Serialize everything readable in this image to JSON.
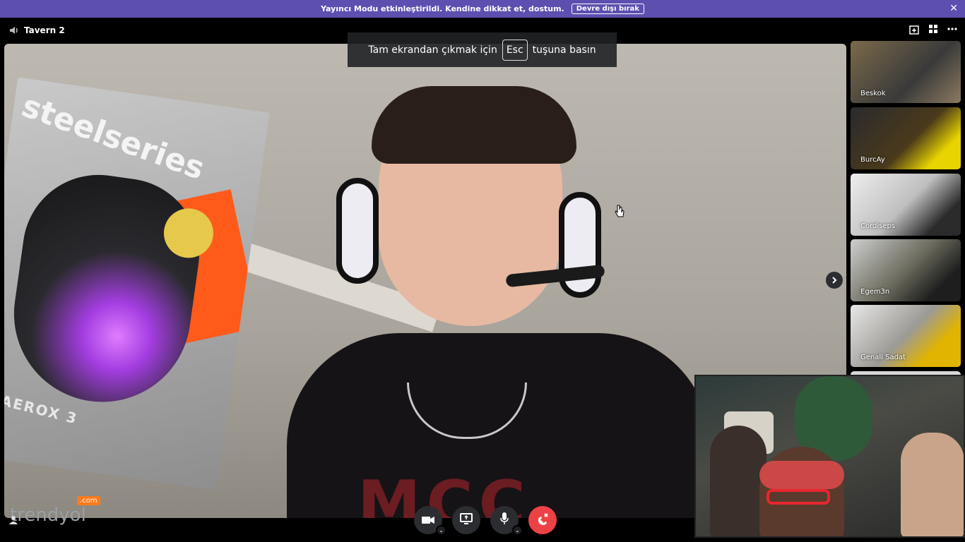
{
  "banner": {
    "message": "Yayıncı Modu etkinleştirildi. Kendine dikkat et, dostum.",
    "dismiss_label": "Devre dışı bırak",
    "close_glyph": "✕"
  },
  "topbar": {
    "channel_icon": "speaker-icon",
    "channel_name": "Tavern 2"
  },
  "fullscreen_hint": {
    "before": "Tam ekrandan çıkmak için",
    "key": "Esc",
    "after": "tuşuna basın"
  },
  "main_video": {
    "box_brand": "steelseries",
    "box_product": "AEROX 3",
    "shirt_logo": "MCC"
  },
  "watermark": {
    "text": "trendyol",
    "dotcom": ".com"
  },
  "sidebar_tools": {
    "icons": [
      "add-activity-icon",
      "grid-icon",
      "more-icon"
    ]
  },
  "participants": [
    {
      "name": "Beskok"
    },
    {
      "name": "BurcAy"
    },
    {
      "name": "Cordiseps"
    },
    {
      "name": "Egem3n"
    },
    {
      "name": "Genali Sadat"
    }
  ],
  "controls": {
    "camera": "camera-icon",
    "screen_share": "screen-share-icon",
    "microphone": "microphone-icon",
    "hangup": "hangup-icon"
  },
  "colors": {
    "banner": "#5d4fb0",
    "hangup": "#ed4245",
    "control_bg": "#2b2d31"
  }
}
